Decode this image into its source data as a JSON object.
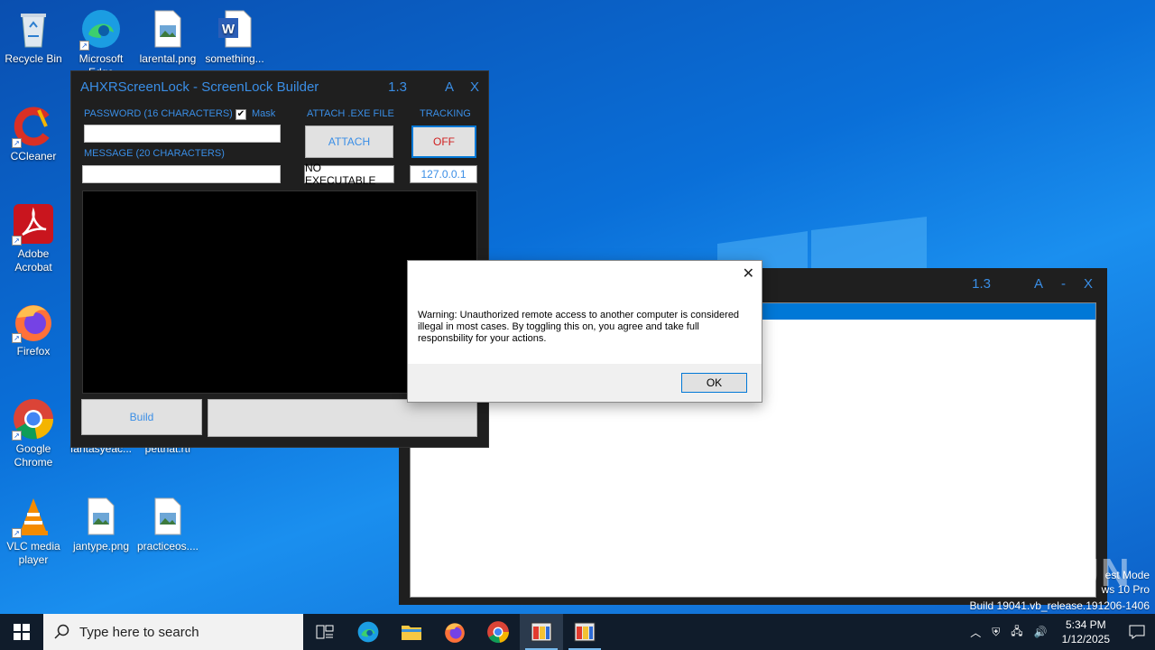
{
  "desktop": {
    "icons": [
      {
        "label": "Recycle Bin"
      },
      {
        "label": "Microsoft Edge"
      },
      {
        "label": "larental.png"
      },
      {
        "label": "something..."
      },
      {
        "label": "CCleaner"
      },
      {
        "label": "Adobe Acrobat"
      },
      {
        "label": "Firefox"
      },
      {
        "label": "Google Chrome"
      },
      {
        "label": "fantasyeac..."
      },
      {
        "label": "petthat.rtf"
      },
      {
        "label": "VLC media player"
      },
      {
        "label": "jantype.png"
      },
      {
        "label": "practiceos...."
      }
    ]
  },
  "builder": {
    "title": "AHXRScreenLock - ScreenLock Builder",
    "version": "1.3",
    "btn_a": "A",
    "btn_close": "X",
    "password_label": "PASSWORD (16 CHARACTERS)",
    "mask_label": "Mask",
    "mask_checked": "✔",
    "message_label": "MESSAGE (20 CHARACTERS)",
    "attach_label": "ATTACH .EXE FILE",
    "attach_button": "ATTACH",
    "attach_value": "NO EXECUTABLE",
    "tracking_label": "TRACKING",
    "tracking_button": "OFF",
    "tracking_ip": "127.0.0.1",
    "build_button": "Build"
  },
  "second_window": {
    "version": "1.3",
    "btn_a": "A",
    "btn_min": "-",
    "btn_close": "X"
  },
  "dialog": {
    "message": "Warning: Unauthorized remote access to another computer is considered illegal in most cases. By toggling this on, you agree and take full responsbility for your actions.",
    "close": "✕",
    "ok": "OK"
  },
  "watermark": {
    "line1": "est Mode",
    "line2": "ws 10 Pro",
    "line3": "Build 19041.vb_release.191206-1406",
    "brand": "ANY RUN"
  },
  "taskbar": {
    "search_placeholder": "Type here to search",
    "time": "5:34 PM",
    "date": "1/12/2025"
  }
}
